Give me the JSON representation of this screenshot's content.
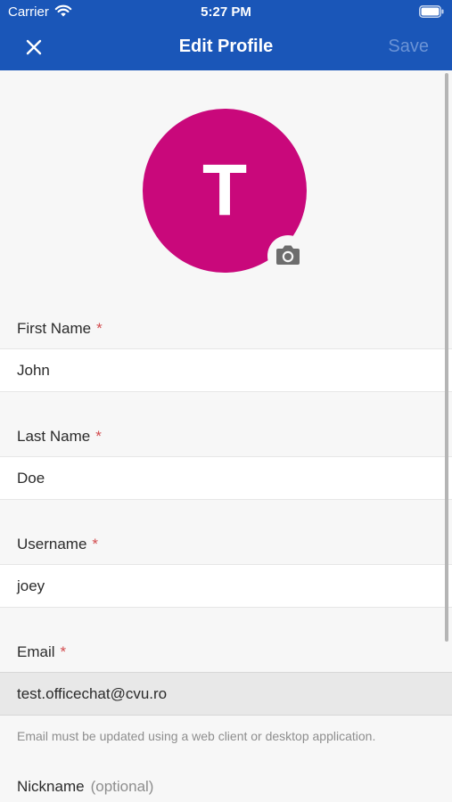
{
  "status_bar": {
    "carrier": "Carrier",
    "time": "5:27 PM"
  },
  "header": {
    "title": "Edit Profile",
    "save_label": "Save",
    "close_icon": "close-icon"
  },
  "avatar": {
    "initial": "T",
    "color": "#c9087b",
    "camera_icon": "camera-icon"
  },
  "fields": [
    {
      "label": "First Name",
      "required_marker": "*",
      "value": "John"
    },
    {
      "label": "Last Name",
      "required_marker": "*",
      "value": "Doe"
    },
    {
      "label": "Username",
      "required_marker": "*",
      "value": "joey"
    },
    {
      "label": "Email",
      "required_marker": "*",
      "value": "test.officechat@cvu.ro",
      "help": "Email must be updated using a web client or desktop application."
    },
    {
      "label": "Nickname",
      "optional_marker": "(optional)"
    }
  ],
  "colors": {
    "header_bg": "#1a56b8",
    "required": "#d24b4e",
    "page_bg": "#f7f7f7"
  }
}
